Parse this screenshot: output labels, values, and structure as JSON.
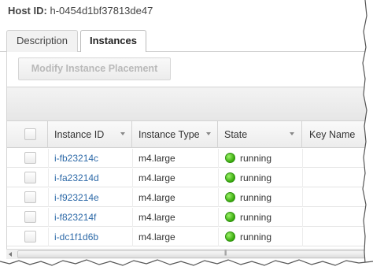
{
  "host": {
    "label": "Host ID:",
    "value": "h-0454d1bf37813de47"
  },
  "tabs": [
    {
      "label": "Description",
      "active": false
    },
    {
      "label": "Instances",
      "active": true
    }
  ],
  "toolbar": {
    "modify_label": "Modify Instance Placement"
  },
  "table": {
    "columns": [
      "Instance ID",
      "Instance Type",
      "State",
      "Key Name"
    ],
    "rows": [
      {
        "id": "i-fb23214c",
        "type": "m4.large",
        "state": "running"
      },
      {
        "id": "i-fa23214d",
        "type": "m4.large",
        "state": "running"
      },
      {
        "id": "i-f923214e",
        "type": "m4.large",
        "state": "running"
      },
      {
        "id": "i-f823214f",
        "type": "m4.large",
        "state": "running"
      },
      {
        "id": "i-dc1f1d6b",
        "type": "m4.large",
        "state": "running"
      }
    ]
  },
  "colors": {
    "link": "#2e6aa8",
    "running": "#36a80a"
  }
}
